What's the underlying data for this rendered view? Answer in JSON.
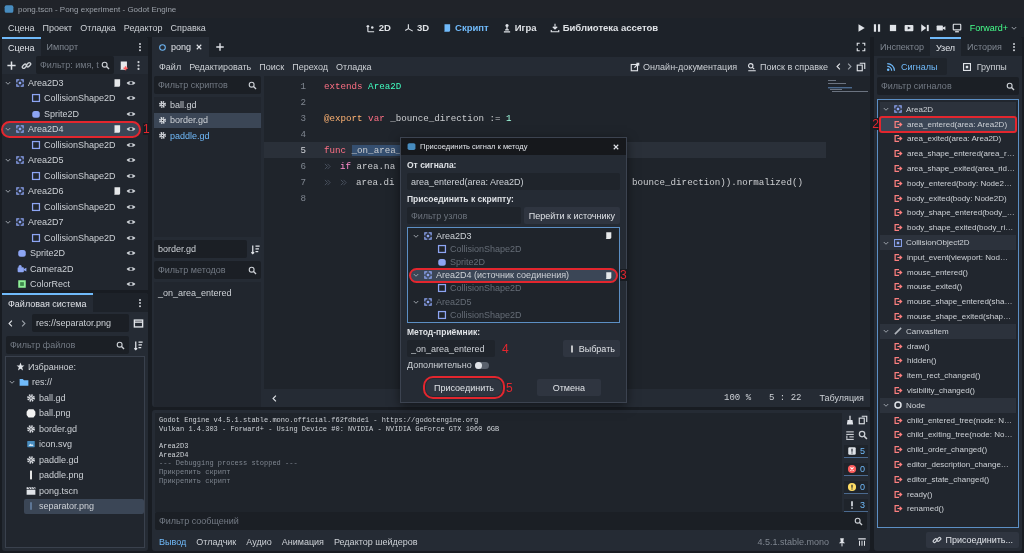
{
  "window": {
    "title": "pong.tscn - Pong experiment - Godot Engine"
  },
  "menu": [
    "Сцена",
    "Проект",
    "Отладка",
    "Редактор",
    "Справка"
  ],
  "workspaces": [
    {
      "label": "2D",
      "kind": "twod",
      "selected": false
    },
    {
      "label": "3D",
      "kind": "threed",
      "selected": false
    },
    {
      "label": "Скрипт",
      "kind": "script",
      "selected": true
    },
    {
      "label": "Игра",
      "kind": "game",
      "selected": false
    },
    {
      "label": "Библиотека ассетов",
      "kind": "assetlib",
      "selected": false
    }
  ],
  "renderer": "Forward+",
  "scene_dock": {
    "tabs": [
      {
        "label": "Сцена",
        "selected": true
      },
      {
        "label": "Импорт",
        "selected": false
      }
    ],
    "filter_placeholder": "Фильтр: имя, t",
    "nodes": [
      {
        "name": "Area2D3",
        "kind": "area",
        "script": true,
        "selected": false,
        "expanded": true,
        "children": [
          {
            "name": "CollisionShape2D",
            "kind": "collision",
            "script": false,
            "selected": false
          },
          {
            "name": "Sprite2D",
            "kind": "sprite",
            "script": false,
            "selected": false
          }
        ]
      },
      {
        "name": "Area2D4",
        "kind": "area",
        "script": true,
        "selected": true,
        "expanded": true,
        "callout": "1",
        "children": [
          {
            "name": "CollisionShape2D",
            "kind": "collision",
            "script": false,
            "selected": false
          }
        ]
      },
      {
        "name": "Area2D5",
        "kind": "area",
        "script": false,
        "selected": false,
        "expanded": true,
        "children": [
          {
            "name": "CollisionShape2D",
            "kind": "collision",
            "script": false,
            "selected": false
          }
        ]
      },
      {
        "name": "Area2D6",
        "kind": "area",
        "script": true,
        "selected": false,
        "expanded": true,
        "children": [
          {
            "name": "CollisionShape2D",
            "kind": "collision",
            "script": false,
            "selected": false
          }
        ]
      },
      {
        "name": "Area2D7",
        "kind": "area",
        "script": false,
        "selected": false,
        "expanded": true,
        "children": [
          {
            "name": "CollisionShape2D",
            "kind": "collision",
            "script": false,
            "selected": false
          }
        ]
      },
      {
        "name": "Sprite2D",
        "kind": "sprite",
        "script": false,
        "selected": false
      },
      {
        "name": "Camera2D",
        "kind": "camera",
        "script": false,
        "selected": false
      },
      {
        "name": "ColorRect",
        "kind": "colorrect",
        "script": false,
        "selected": false
      }
    ]
  },
  "filesystem": {
    "tab": "Файловая система",
    "path": "res://separator.png",
    "filter_placeholder": "Фильтр файлов",
    "favorites": "Избранное:",
    "root": {
      "name": "res://",
      "expanded": true,
      "children": [
        {
          "name": "ball.gd",
          "kind": "script",
          "selected": false
        },
        {
          "name": "ball.png",
          "kind": "image",
          "selected": false
        },
        {
          "name": "border.gd",
          "kind": "script",
          "selected": false
        },
        {
          "name": "icon.svg",
          "kind": "svg",
          "selected": false
        },
        {
          "name": "paddle.gd",
          "kind": "script",
          "selected": false
        },
        {
          "name": "paddle.png",
          "kind": "bar",
          "selected": false
        },
        {
          "name": "pong.tscn",
          "kind": "scene",
          "selected": false
        },
        {
          "name": "separator.png",
          "kind": "thinbar",
          "selected": true
        }
      ]
    }
  },
  "script_editor": {
    "tabs": [
      {
        "label": "pong",
        "selected": true
      }
    ],
    "menu": [
      "Файл",
      "Редактировать",
      "Поиск",
      "Переход",
      "Отладка"
    ],
    "help_links": [
      {
        "label": "Онлайн-документация",
        "kind": "docs"
      },
      {
        "label": "Поиск в справке",
        "kind": "help"
      }
    ],
    "scripts_filter_placeholder": "Фильтр скриптов",
    "scripts": [
      {
        "name": "ball.gd",
        "selected": false,
        "tinted": false
      },
      {
        "name": "border.gd",
        "selected": true,
        "tinted": false
      },
      {
        "name": "paddle.gd",
        "selected": false,
        "tinted": true
      }
    ],
    "current_script": "border.gd",
    "methods_filter_placeholder": "Фильтр методов",
    "methods": [
      "_on_area_entered"
    ],
    "lines": [
      {
        "n": "1",
        "current": false,
        "tokens": [
          {
            "t": "extends",
            "kind": "keyword"
          },
          {
            "t": " Area2D",
            "kind": "type"
          }
        ]
      },
      {
        "n": "2",
        "current": false
      },
      {
        "n": "3",
        "current": false,
        "tokens": [
          {
            "t": "@export",
            "kind": "annotation"
          },
          {
            "t": " var",
            "kind": "keyword"
          },
          {
            "t": " _bounce_direction := ",
            "kind": "plain"
          },
          {
            "t": "1",
            "kind": "number"
          }
        ]
      },
      {
        "n": "4",
        "current": false
      },
      {
        "n": "5",
        "current": true,
        "tokens": [
          {
            "t": "func ",
            "kind": "keyword"
          },
          {
            "t": "_on_area_",
            "kind": "selection"
          }
        ]
      },
      {
        "n": "6",
        "current": false,
        "tokens": [
          {
            "kind": "tab"
          },
          {
            "t": "if",
            "kind": "control"
          },
          {
            "t": " area.na",
            "kind": "plain"
          }
        ]
      },
      {
        "n": "7",
        "current": false,
        "tokens": [
          {
            "kind": "tab"
          },
          {
            "kind": "tab"
          },
          {
            "t": "area.di",
            "kind": "plain"
          }
        ],
        "tail": "bounce_direction)).normalized()"
      },
      {
        "n": "8",
        "current": false
      }
    ],
    "status": {
      "zoom": "100 %",
      "position": "5 :  22",
      "indent": "Табуляция"
    }
  },
  "output": {
    "lines": [
      {
        "t": "Godot Engine v4.5.1.stable.mono.official.f62fdbde1 - https://godotengine.org",
        "kind": "normal"
      },
      {
        "t": "Vulkan 1.4.303 - Forward+ - Using Device #0: NVIDIA - NVIDIA GeForce GTX 1060 6GB",
        "kind": "normal"
      },
      {
        "t": "Area2D3",
        "kind": "normal",
        "gap_before": true
      },
      {
        "t": "Area2D4",
        "kind": "normal"
      },
      {
        "t": "--- Debugging process stopped ---",
        "kind": "dim"
      },
      {
        "t": "Прикрепить скрипт",
        "kind": "dim"
      },
      {
        "t": "Прикрепить скрипт",
        "kind": "dim"
      }
    ],
    "counters": [
      {
        "kind": "message",
        "count": "5"
      },
      {
        "kind": "error",
        "count": "0"
      },
      {
        "kind": "warning",
        "count": "0"
      },
      {
        "kind": "info",
        "count": "3"
      }
    ],
    "filter_placeholder": "Фильтр сообщений",
    "tabs": [
      {
        "label": "Вывод",
        "selected": true
      },
      {
        "label": "Отладчик",
        "selected": false
      },
      {
        "label": "Аудио",
        "selected": false
      },
      {
        "label": "Анимация",
        "selected": false
      },
      {
        "label": "Редактор шейдеров",
        "selected": false
      }
    ],
    "version": "4.5.1.stable.mono"
  },
  "node_dock": {
    "tabs": [
      {
        "label": "Инспектор",
        "selected": false
      },
      {
        "label": "Узел",
        "selected": true
      },
      {
        "label": "История",
        "selected": false
      }
    ],
    "subtabs": [
      {
        "label": "Сигналы",
        "kind": "signals",
        "selected": true
      },
      {
        "label": "Группы",
        "kind": "groups",
        "selected": false
      }
    ],
    "filter_placeholder": "Фильтр сигналов",
    "groups": [
      {
        "name": "Area2D",
        "kind": "area",
        "expanded": true,
        "signals": [
          {
            "name": "area_entered(area: Area2D)",
            "selected": true,
            "callout": "2"
          },
          {
            "name": "area_exited(area: Area2D)",
            "selected": false
          },
          {
            "name": "area_shape_entered(area_r…",
            "selected": false
          },
          {
            "name": "area_shape_exited(area_rid…",
            "selected": false
          },
          {
            "name": "body_entered(body: Node2…",
            "selected": false
          },
          {
            "name": "body_exited(body: Node2D)",
            "selected": false
          },
          {
            "name": "body_shape_entered(body_…",
            "selected": false
          },
          {
            "name": "body_shape_exited(body_ri…",
            "selected": false
          }
        ]
      },
      {
        "name": "CollisionObject2D",
        "kind": "collision-object",
        "expanded": true,
        "signals": [
          {
            "name": "input_event(viewport: Nod…",
            "selected": false
          },
          {
            "name": "mouse_entered()",
            "selected": false
          },
          {
            "name": "mouse_exited()",
            "selected": false
          },
          {
            "name": "mouse_shape_entered(sha…",
            "selected": false
          },
          {
            "name": "mouse_shape_exited(shap…",
            "selected": false
          }
        ]
      },
      {
        "name": "CanvasItem",
        "kind": "canvas",
        "expanded": true,
        "signals": [
          {
            "name": "draw()",
            "selected": false
          },
          {
            "name": "hidden()",
            "selected": false
          },
          {
            "name": "item_rect_changed()",
            "selected": false
          },
          {
            "name": "visibility_changed()",
            "selected": false
          }
        ]
      },
      {
        "name": "Node",
        "kind": "node",
        "expanded": true,
        "signals": [
          {
            "name": "child_entered_tree(node: N…",
            "selected": false
          },
          {
            "name": "child_exiting_tree(node: No…",
            "selected": false
          },
          {
            "name": "child_order_changed()",
            "selected": false
          },
          {
            "name": "editor_description_change…",
            "selected": false
          },
          {
            "name": "editor_state_changed()",
            "selected": false
          },
          {
            "name": "ready()",
            "selected": false
          },
          {
            "name": "renamed()",
            "selected": false
          }
        ]
      }
    ],
    "connect_button": "Присоединить..."
  },
  "dialog": {
    "title": "Присоединить сигнал к методу",
    "from_label": "От сигнала:",
    "signal": "area_entered(area: Area2D)",
    "to_label": "Присоединить к скрипту:",
    "node_filter_placeholder": "Фильтр узлов",
    "goto_button": "Перейти к источнику",
    "tree": [
      {
        "name": "Area2D3",
        "kind": "area",
        "script": true,
        "disabled": false,
        "selected": false,
        "expanded": true,
        "children": [
          {
            "name": "CollisionShape2D",
            "kind": "collision",
            "script": false,
            "disabled": true,
            "selected": false
          },
          {
            "name": "Sprite2D",
            "kind": "sprite",
            "script": false,
            "disabled": true,
            "selected": false
          }
        ]
      },
      {
        "name": "Area2D4 (источник соединения)",
        "kind": "area",
        "script": true,
        "disabled": false,
        "selected": true,
        "expanded": true,
        "callout": "3",
        "children": [
          {
            "name": "CollisionShape2D",
            "kind": "collision",
            "script": false,
            "disabled": true,
            "selected": false
          }
        ]
      },
      {
        "name": "Area2D5",
        "kind": "area",
        "script": false,
        "disabled": true,
        "selected": false,
        "expanded": true,
        "children": [
          {
            "name": "CollisionShape2D",
            "kind": "collision",
            "script": false,
            "disabled": true,
            "selected": false
          }
        ]
      }
    ],
    "method_label": "Метод-приёмник:",
    "method": "_on_area_entered",
    "method_callout": "4",
    "pick_button": "Выбрать",
    "advanced_label": "Дополнительно",
    "advanced_on": false,
    "connect_button": "Присоединить",
    "connect_callout": "5",
    "cancel_button": "Отмена"
  }
}
